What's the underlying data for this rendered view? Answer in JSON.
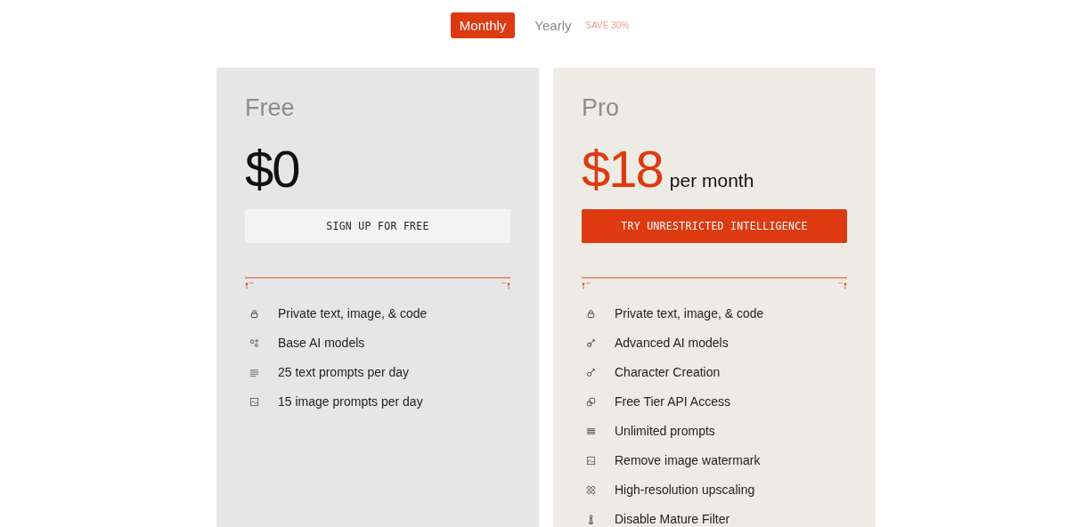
{
  "billing_tabs": [
    {
      "label": "Monthly",
      "selected": true
    },
    {
      "label": "Yearly",
      "selected": false,
      "note": "SAVE 30%"
    }
  ],
  "plans": [
    {
      "name": "Free",
      "price": "$0",
      "highlight": false,
      "button": "SIGN UP FOR FREE",
      "features": [
        {
          "kind": "lock",
          "text": "Private text, image, & code"
        },
        {
          "kind": "nodes",
          "text": "Base AI models"
        },
        {
          "kind": "lines",
          "text": "25 text prompts per day"
        },
        {
          "kind": "image",
          "text": "15 image prompts per day"
        }
      ]
    },
    {
      "name": "Pro",
      "price": "$18",
      "period": "per month",
      "highlight": true,
      "button": "TRY UNRESTRICTED INTELLIGENCE",
      "features": [
        {
          "kind": "lock",
          "text": "Private text, image, & code"
        },
        {
          "kind": "key",
          "text": "Advanced AI models"
        },
        {
          "kind": "key",
          "text": "Character Creation"
        },
        {
          "kind": "copy",
          "text": "Free Tier API Access"
        },
        {
          "kind": "menu",
          "text": "Unlimited prompts"
        },
        {
          "kind": "image",
          "text": "Remove image watermark"
        },
        {
          "kind": "grid",
          "text": "High-resolution upscaling"
        },
        {
          "kind": "figure",
          "text": "Disable Mature Filter"
        }
      ]
    }
  ]
}
